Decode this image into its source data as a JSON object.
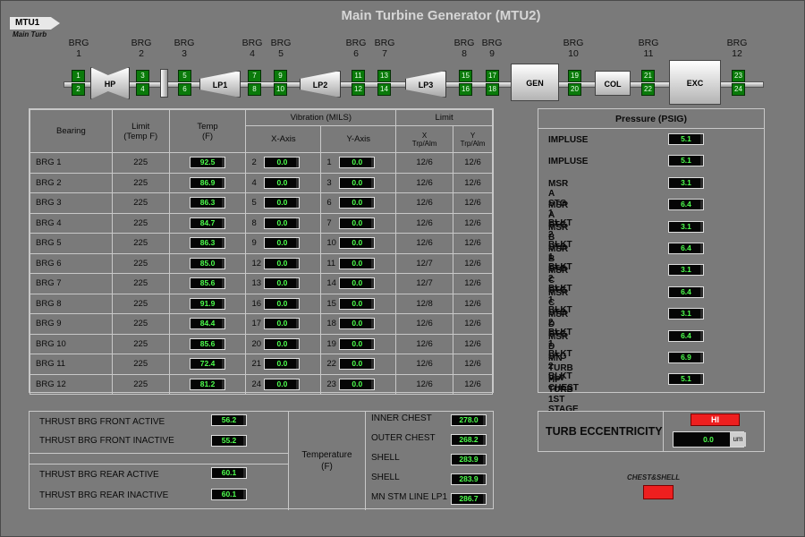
{
  "nav": {
    "tag": "MTU1",
    "subtitle": "Main Turb"
  },
  "title": "Main Turbine Generator  (MTU2)",
  "train": {
    "bearings": [
      "1",
      "2",
      "3",
      "4",
      "5",
      "6",
      "7",
      "8",
      "9",
      "10",
      "11",
      "12"
    ],
    "brg_prefix": "BRG",
    "components": {
      "hp": "HP",
      "lp1": "LP1",
      "lp2": "LP2",
      "lp3": "LP3",
      "gen": "GEN",
      "col": "COL",
      "exc": "EXC"
    },
    "sensors": [
      "1",
      "2",
      "3",
      "4",
      "5",
      "6",
      "7",
      "8",
      "9",
      "10",
      "11",
      "12",
      "13",
      "14",
      "15",
      "16",
      "17",
      "18",
      "19",
      "20",
      "21",
      "22",
      "23",
      "24"
    ]
  },
  "bearing_table": {
    "headers": {
      "bearing": "Bearing",
      "limit": "Limit",
      "limit_unit": "(Temp F)",
      "temp": "Temp",
      "temp_unit": "(F)",
      "vibration": "Vibration (MILS)",
      "x_axis": "X-Axis",
      "y_axis": "Y-Axis",
      "limit2": "Limit",
      "x_limit": "X",
      "y_limit": "Y",
      "trp_alm": "Trp/Alm"
    },
    "rows": [
      {
        "name": "BRG 1",
        "limit": "225",
        "temp": "92.5",
        "xn": "2",
        "xv": "0.0",
        "yn": "1",
        "yv": "0.0",
        "xl": "12/6",
        "yl": "12/6"
      },
      {
        "name": "BRG 2",
        "limit": "225",
        "temp": "86.9",
        "xn": "4",
        "xv": "0.0",
        "yn": "3",
        "yv": "0.0",
        "xl": "12/6",
        "yl": "12/6"
      },
      {
        "name": "BRG 3",
        "limit": "225",
        "temp": "86.3",
        "xn": "5",
        "xv": "0.0",
        "yn": "6",
        "yv": "0.0",
        "xl": "12/6",
        "yl": "12/6"
      },
      {
        "name": "BRG 4",
        "limit": "225",
        "temp": "84.7",
        "xn": "8",
        "xv": "0.0",
        "yn": "7",
        "yv": "0.0",
        "xl": "12/6",
        "yl": "12/6"
      },
      {
        "name": "BRG 5",
        "limit": "225",
        "temp": "86.3",
        "xn": "9",
        "xv": "0.0",
        "yn": "10",
        "yv": "0.0",
        "xl": "12/6",
        "yl": "12/6"
      },
      {
        "name": "BRG 6",
        "limit": "225",
        "temp": "85.0",
        "xn": "12",
        "xv": "0.0",
        "yn": "11",
        "yv": "0.0",
        "xl": "12/7",
        "yl": "12/6"
      },
      {
        "name": "BRG 7",
        "limit": "225",
        "temp": "85.6",
        "xn": "13",
        "xv": "0.0",
        "yn": "14",
        "yv": "0.0",
        "xl": "12/7",
        "yl": "12/6"
      },
      {
        "name": "BRG 8",
        "limit": "225",
        "temp": "91.9",
        "xn": "16",
        "xv": "0.0",
        "yn": "15",
        "yv": "0.0",
        "xl": "12/8",
        "yl": "12/6"
      },
      {
        "name": "BRG 9",
        "limit": "225",
        "temp": "84.4",
        "xn": "17",
        "xv": "0.0",
        "yn": "18",
        "yv": "0.0",
        "xl": "12/6",
        "yl": "12/6"
      },
      {
        "name": "BRG 10",
        "limit": "225",
        "temp": "85.6",
        "xn": "20",
        "xv": "0.0",
        "yn": "19",
        "yv": "0.0",
        "xl": "12/6",
        "yl": "12/6"
      },
      {
        "name": "BRG 11",
        "limit": "225",
        "temp": "72.4",
        "xn": "21",
        "xv": "0.0",
        "yn": "22",
        "yv": "0.0",
        "xl": "12/6",
        "yl": "12/6"
      },
      {
        "name": "BRG 12",
        "limit": "225",
        "temp": "81.2",
        "xn": "24",
        "xv": "0.0",
        "yn": "23",
        "yv": "0.0",
        "xl": "12/6",
        "yl": "12/6"
      }
    ]
  },
  "pressure": {
    "title": "Pressure (PSIG)",
    "rows": [
      {
        "label": "IMPLUSE",
        "value": "5.1"
      },
      {
        "label": "IMPLUSE",
        "value": "5.1"
      },
      {
        "label": "MSR A STG 1 BLKT",
        "value": "3.1"
      },
      {
        "label": "MSR A STG 2 BLKT",
        "value": "6.4"
      },
      {
        "label": "MSR B STG 1 BLKT",
        "value": "3.1"
      },
      {
        "label": "MSR B STG 2 BLKT",
        "value": "6.4"
      },
      {
        "label": "MSR C STG 1 BLKT",
        "value": "3.1"
      },
      {
        "label": "MSR C STG 2 BLKT",
        "value": "6.4"
      },
      {
        "label": "MSR D STG 1 BLKT",
        "value": "3.1"
      },
      {
        "label": "MSR D STG 2 BLKT",
        "value": "6.4"
      },
      {
        "label": "MN TURB VLV CHEST",
        "value": "6.9"
      },
      {
        "label": "HP TURB 1ST STAGE",
        "value": "5.1"
      }
    ]
  },
  "thrust": {
    "front_active": {
      "label": "THRUST BRG FRONT ACTIVE",
      "value": "56.2"
    },
    "front_inactive": {
      "label": "THRUST BRG FRONT INACTIVE",
      "value": "55.2"
    },
    "rear_active": {
      "label": "THRUST BRG REAR ACTIVE",
      "value": "60.1"
    },
    "rear_inactive": {
      "label": "THRUST BRG REAR INACTIVE",
      "value": "60.1"
    }
  },
  "temperature": {
    "label": "Temperature",
    "unit": "(F)",
    "rows": [
      {
        "label": "INNER CHEST",
        "value": "278.0"
      },
      {
        "label": "OUTER CHEST",
        "value": "268.2"
      },
      {
        "label": "SHELL",
        "value": "283.9"
      },
      {
        "label": "SHELL",
        "value": "283.9"
      },
      {
        "label": "MN STM LINE LP1",
        "value": "286.7"
      }
    ]
  },
  "eccentricity": {
    "label": "TURB ECCENTRICITY",
    "status": "HI",
    "value": "0.0",
    "unit": "um"
  },
  "chest_shell": {
    "label": "CHEST&SHELL"
  },
  "colors": {
    "background": "#7a7a7a",
    "sensor_green": "#0a7a0a",
    "value_text": "#4dff4d",
    "alarm_red": "#ee1f1f"
  }
}
